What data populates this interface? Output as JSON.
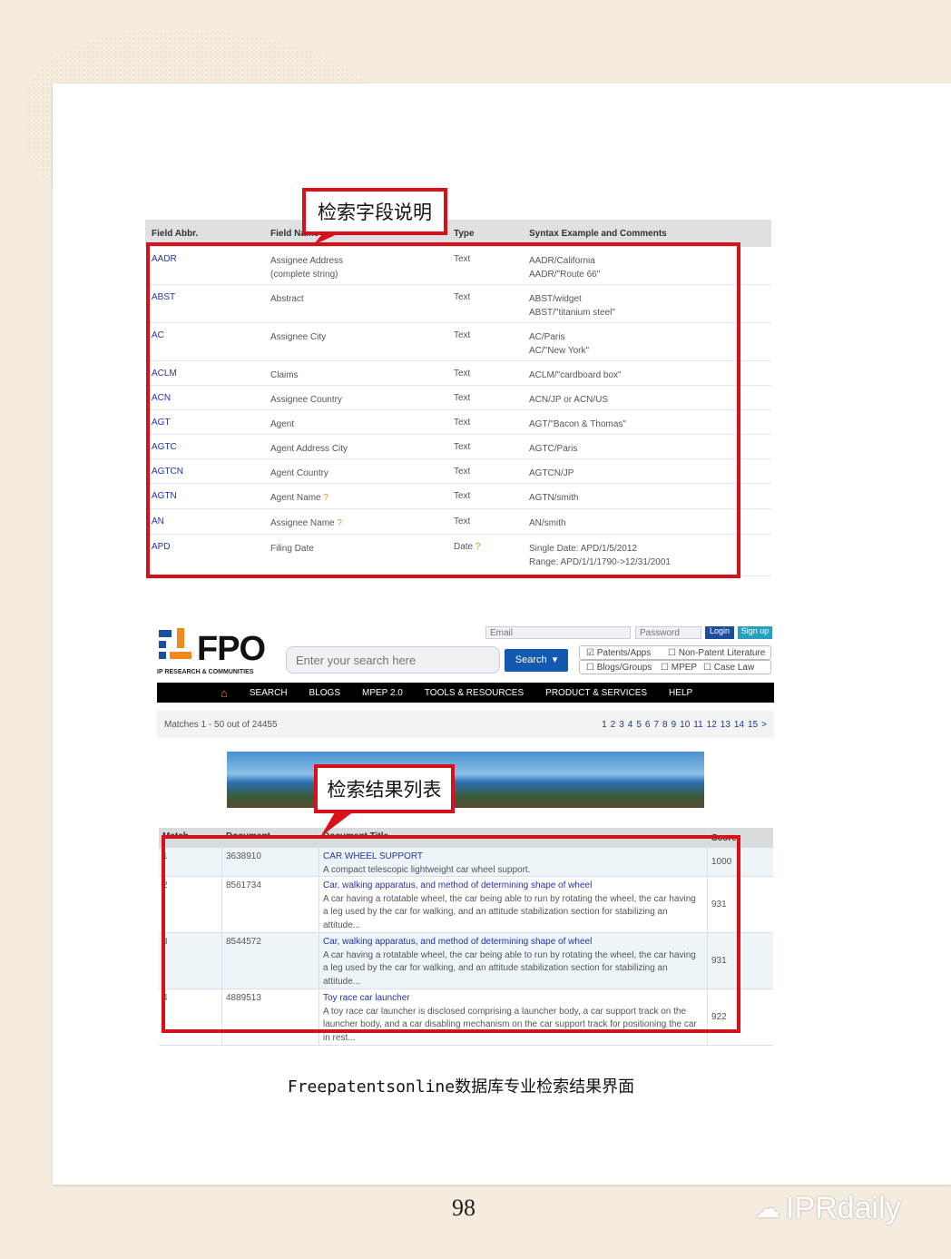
{
  "field_table": {
    "headers": [
      "Field Abbr.",
      "Field Name",
      "Type",
      "Syntax Example and Comments"
    ],
    "rows": [
      {
        "abbr": "AADR",
        "name": "Assignee Address",
        "name2": "(complete string)",
        "type": "Text",
        "syntax": [
          "AADR/California",
          "AADR/\"Route 66\""
        ]
      },
      {
        "abbr": "ABST",
        "name": "Abstract",
        "type": "Text",
        "syntax": [
          "ABST/widget",
          "ABST/\"titanium steel\""
        ]
      },
      {
        "abbr": "AC",
        "name": "Assignee City",
        "type": "Text",
        "syntax": [
          "AC/Paris",
          "AC/\"New York\""
        ]
      },
      {
        "abbr": "ACLM",
        "name": "Claims",
        "type": "Text",
        "syntax": [
          "ACLM/\"cardboard box\""
        ]
      },
      {
        "abbr": "ACN",
        "name": "Assignee Country",
        "type": "Text",
        "syntax": [
          "ACN/JP or ACN/US"
        ]
      },
      {
        "abbr": "AGT",
        "name": "Agent",
        "type": "Text",
        "syntax": [
          "AGT/\"Bacon & Thomas\""
        ]
      },
      {
        "abbr": "AGTC",
        "name": "Agent Address City",
        "type": "Text",
        "syntax": [
          "AGTC/Paris"
        ]
      },
      {
        "abbr": "AGTCN",
        "name": "Agent Country",
        "type": "Text",
        "syntax": [
          "AGTCN/JP"
        ]
      },
      {
        "abbr": "AGTN",
        "name": "Agent Name",
        "help": "?",
        "type": "Text",
        "syntax": [
          "AGTN/smith"
        ]
      },
      {
        "abbr": "AN",
        "name": "Assignee Name",
        "help": "?",
        "type": "Text",
        "syntax": [
          "AN/smith"
        ]
      },
      {
        "abbr": "APD",
        "name": "Filing Date",
        "type": "Date",
        "type_help": "?",
        "syntax": [
          "Single Date: APD/1/5/2012",
          "Range: APD/1/1/1790->12/31/2001"
        ]
      }
    ]
  },
  "callouts": {
    "fields": "检索字段说明",
    "results": "检索结果列表"
  },
  "fpo": {
    "logo": "FPO",
    "logo_sub": "IP RESEARCH & COMMUNITIES",
    "email_placeholder": "Email",
    "password_placeholder": "Password",
    "login": "Login",
    "signup": "Sign up",
    "search_placeholder": "Enter your search here",
    "search_button": "Search",
    "checkboxes": [
      {
        "label": "Patents/Apps",
        "checked": true
      },
      {
        "label": "Non-Patent Literature",
        "checked": false
      },
      {
        "label": "Blogs/Groups",
        "checked": false
      },
      {
        "label": "MPEP",
        "checked": false
      },
      {
        "label": "Case Law",
        "checked": false
      }
    ],
    "nav": [
      "SEARCH",
      "BLOGS",
      "MPEP 2.0",
      "TOOLS & RESOURCES",
      "PRODUCT & SERVICES",
      "HELP"
    ],
    "matches": "Matches 1 - 50 out of 24455",
    "pages": [
      "1",
      "2",
      "3",
      "4",
      "5",
      "6",
      "7",
      "8",
      "9",
      "10",
      "11",
      "12",
      "13",
      "14",
      "15",
      ">"
    ]
  },
  "results": {
    "headers": [
      "Match",
      "Document",
      "Document Title",
      "Score"
    ],
    "rows": [
      {
        "match": "1",
        "doc": "3638910",
        "title": "CAR WHEEL SUPPORT",
        "abstract": "A compact telescopic lightweight car wheel support.",
        "score": "1000"
      },
      {
        "match": "2",
        "doc": "8561734",
        "title": "Car, walking apparatus, and method of determining shape of wheel",
        "abstract": "A car having a rotatable wheel, the car being able to run by rotating the wheel, the car having a leg used by the car for walking, and an attitude stabilization section for stabilizing an attitude...",
        "score": "931"
      },
      {
        "match": "3",
        "doc": "8544572",
        "title": "Car, walking apparatus, and method of determining shape of wheel",
        "abstract": "A car having a rotatable wheel, the car being able to run by rotating the wheel, the car having a leg used by the car for walking, and an attitude stabilization section for stabilizing an attitude...",
        "score": "931"
      },
      {
        "match": "4",
        "doc": "4889513",
        "title": "Toy race car launcher",
        "abstract": "A toy race car launcher is disclosed comprising a launcher body, a car support track on the launcher body, and a car disabling mechanism on the car support track for positioning the car in rest...",
        "score": "922"
      }
    ]
  },
  "caption": "Freepatentsonline数据库专业检索结果界面",
  "page_number": "98",
  "watermark": "IPRdaily",
  "colors": {
    "highlight": "#d8101a",
    "link": "#2233aa",
    "nav": "#000000"
  }
}
